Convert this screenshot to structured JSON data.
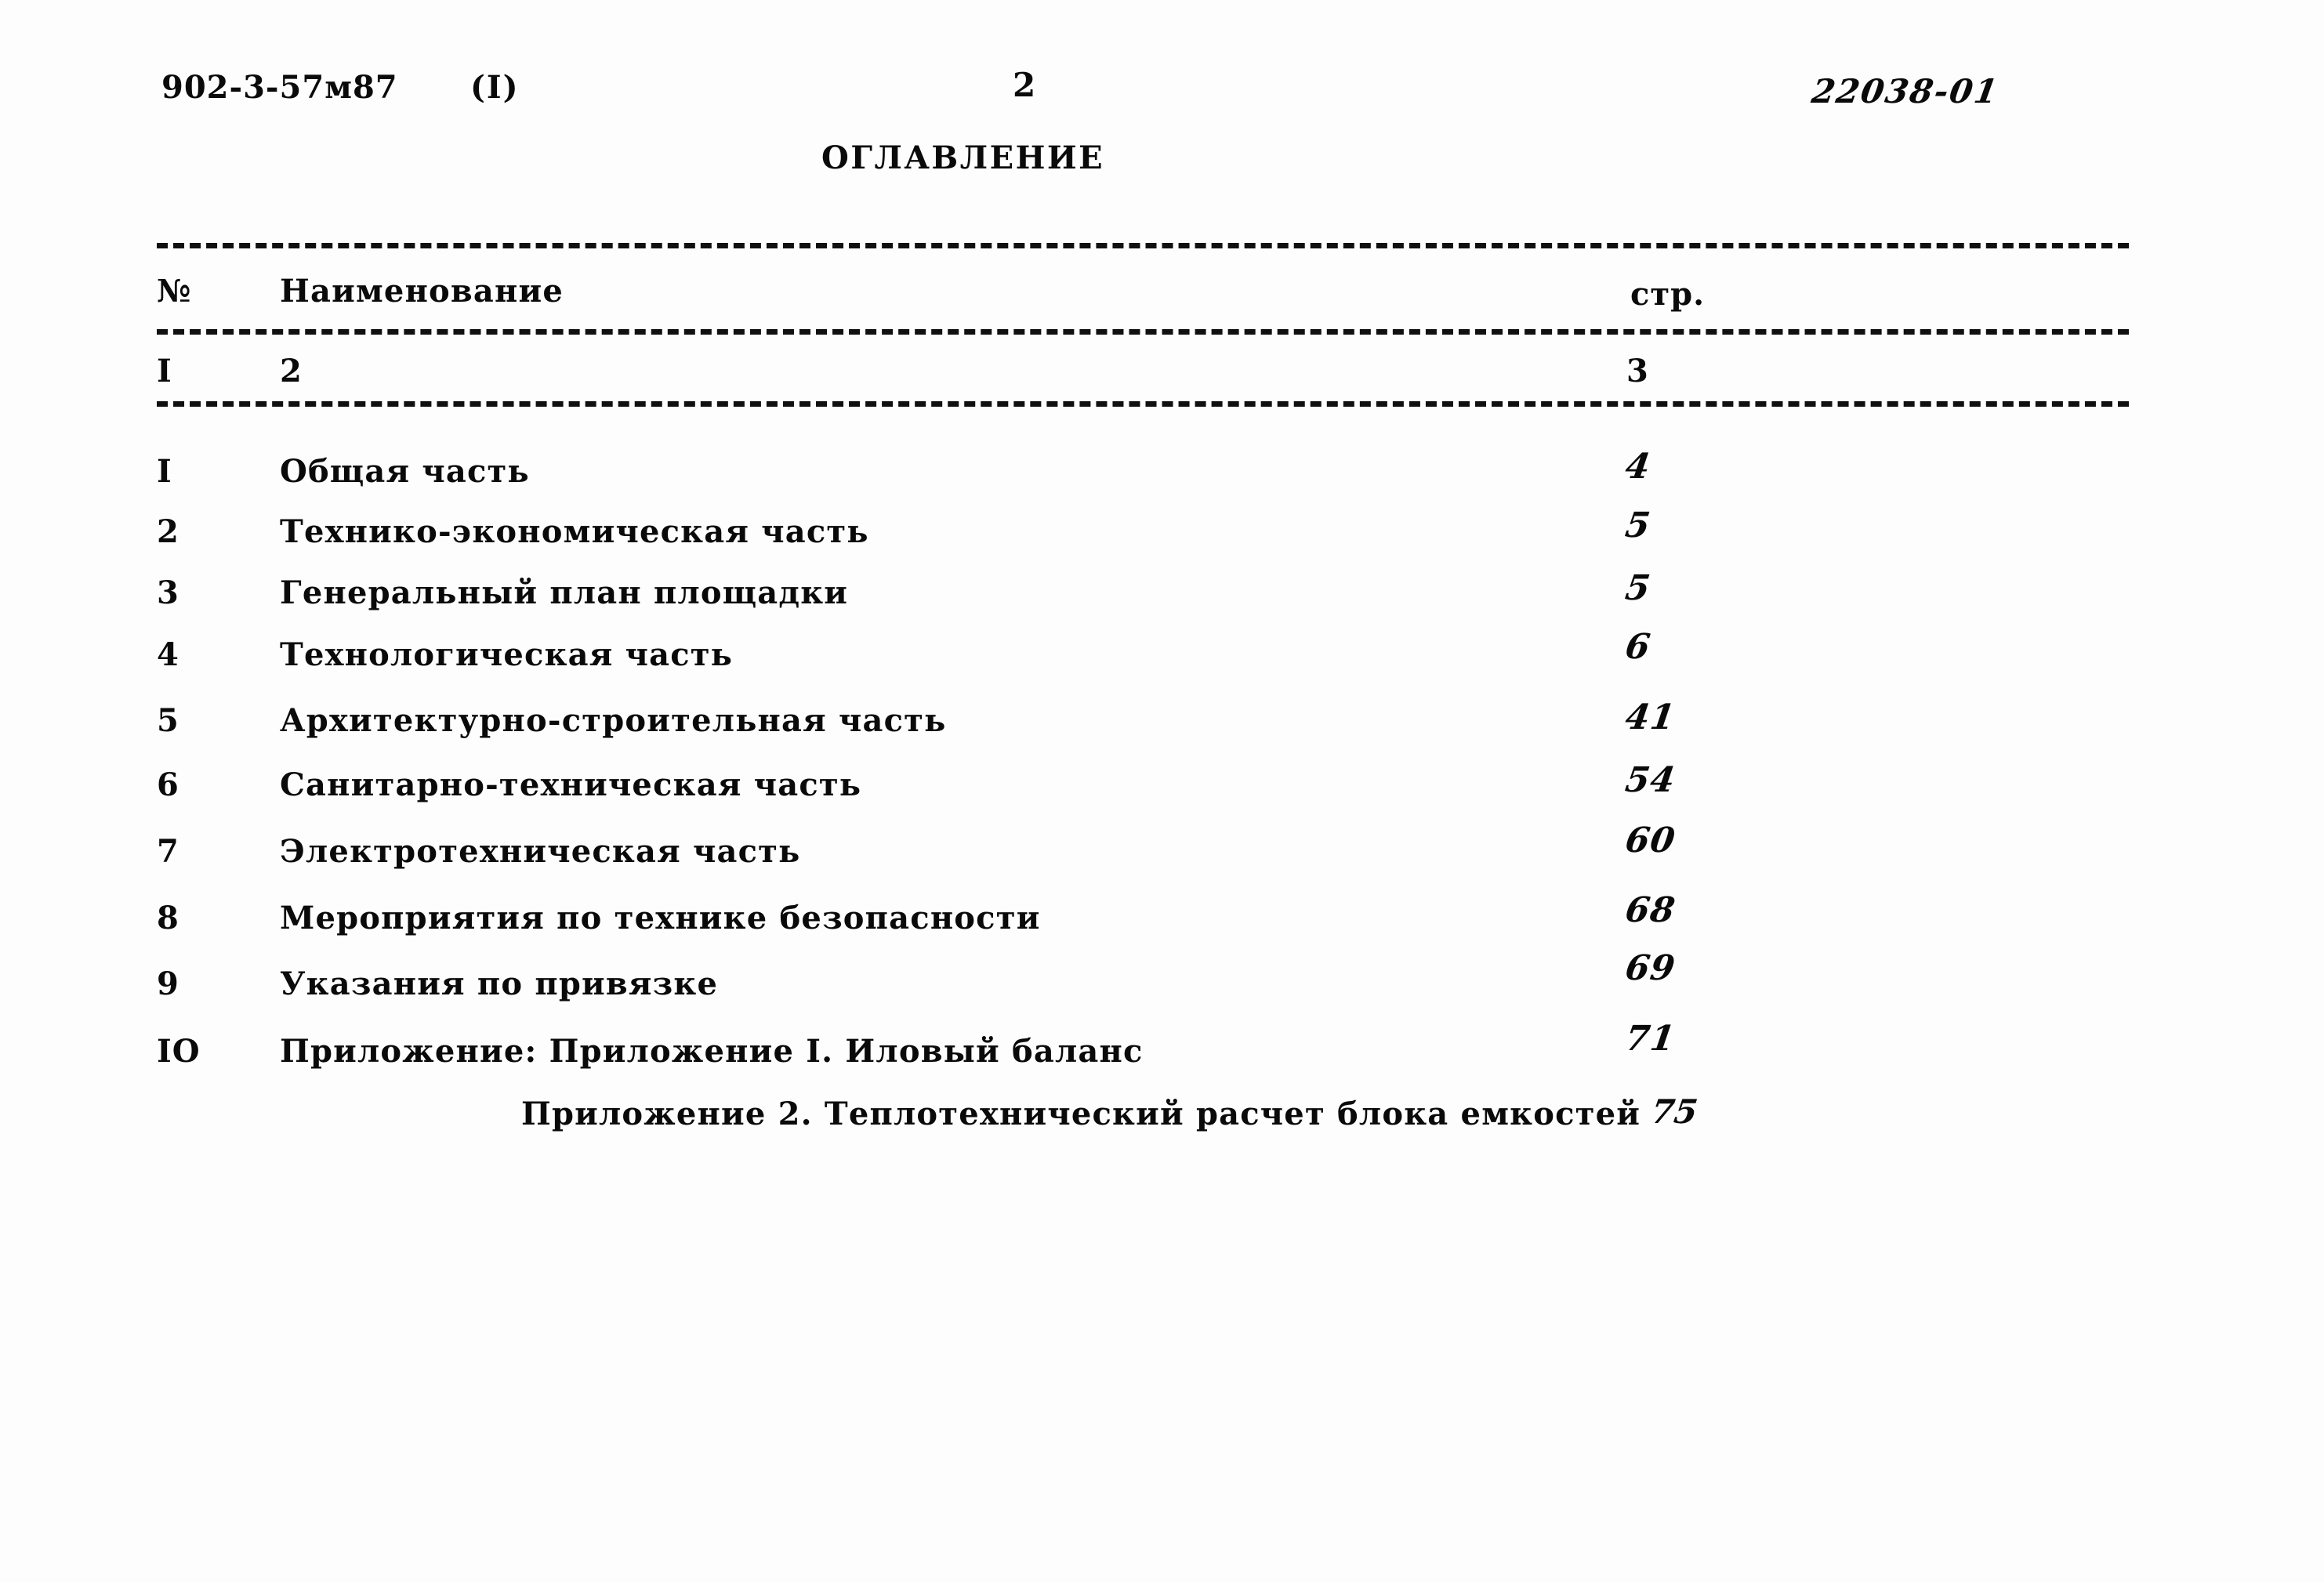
{
  "header": {
    "doc_code": "902-3-57м87",
    "part_marker": "(I)",
    "page_number": "2",
    "archive_code": "22038-01",
    "title": "ОГЛАВЛЕНИЕ"
  },
  "table": {
    "columns": {
      "number_header": "№",
      "name_header": "Наименование",
      "page_header": "стр."
    },
    "column_index_row": {
      "number": "I",
      "name": "2",
      "page": "3"
    },
    "rows": [
      {
        "number": "I",
        "name": "Общая часть",
        "page": "4"
      },
      {
        "number": "2",
        "name": "Технико-экономическая часть",
        "page": "5"
      },
      {
        "number": "3",
        "name": "Генеральный план площадки",
        "page": "5"
      },
      {
        "number": "4",
        "name": "Технологическая часть",
        "page": "6"
      },
      {
        "number": "5",
        "name": "Архитектурно-строительная часть",
        "page": "41"
      },
      {
        "number": "6",
        "name": "Санитарно-техническая часть",
        "page": "54"
      },
      {
        "number": "7",
        "name": "Электротехническая часть",
        "page": "60"
      },
      {
        "number": "8",
        "name": "Мероприятия по технике безопасности",
        "page": "68"
      },
      {
        "number": "9",
        "name": "Указания по привязке",
        "page": "69"
      },
      {
        "number": "IO",
        "name": "Приложение: Приложение I. Иловый баланс",
        "page": "71"
      }
    ],
    "continuation": {
      "name": "Приложение 2. Теплотехнический расчет блока емкостей",
      "page": "75"
    }
  }
}
